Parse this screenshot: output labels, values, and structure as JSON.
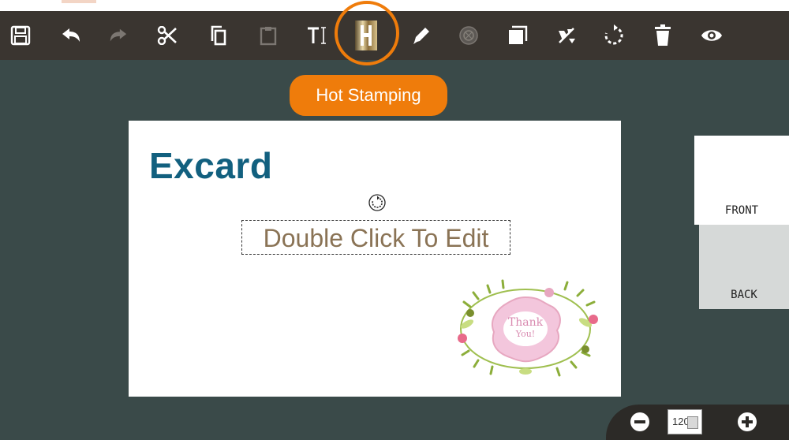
{
  "toolbar": {
    "buttons": [
      {
        "name": "save-icon"
      },
      {
        "name": "undo-icon"
      },
      {
        "name": "redo-icon"
      },
      {
        "name": "cut-icon"
      },
      {
        "name": "copy-icon"
      },
      {
        "name": "paste-icon"
      },
      {
        "name": "text-tool-icon"
      },
      {
        "name": "hot-stamping-icon"
      },
      {
        "name": "pen-icon"
      },
      {
        "name": "emboss-icon"
      },
      {
        "name": "layer-icon"
      },
      {
        "name": "clear-format-icon"
      },
      {
        "name": "reset-icon"
      },
      {
        "name": "delete-icon"
      },
      {
        "name": "preview-eye-icon"
      }
    ],
    "tooltip": "Hot Stamping",
    "highlight_color": "#ef7c0b"
  },
  "card": {
    "brand": "Excard",
    "editable_text": "Double Click To Edit",
    "sticker_text_line1": "Thank",
    "sticker_text_line2": "You!"
  },
  "sides": {
    "front": "FRONT",
    "back": "BACK"
  },
  "zoom": {
    "value": "120"
  },
  "colors": {
    "canvas_bg": "#3a4a49",
    "toolbar_bg": "#3a3530",
    "brand": "#12607f",
    "edit_text": "#8a7355"
  }
}
